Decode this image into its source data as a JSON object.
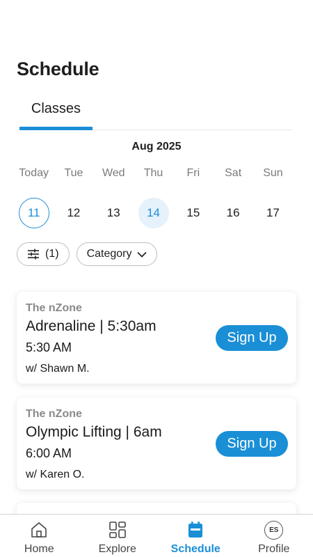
{
  "header": {
    "title": "Schedule"
  },
  "tabs": [
    {
      "label": "Classes",
      "active": true
    }
  ],
  "calendar": {
    "month": "Aug 2025",
    "weekdays": [
      "Today",
      "Tue",
      "Wed",
      "Thu",
      "Fri",
      "Sat",
      "Sun"
    ],
    "dates": [
      "11",
      "12",
      "13",
      "14",
      "15",
      "16",
      "17"
    ],
    "today_index": 0,
    "selected_index": 3
  },
  "filters": {
    "filter_count": "(1)",
    "category_label": "Category"
  },
  "classes": [
    {
      "venue": "The nZone",
      "name": "Adrenaline | 5:30am",
      "time": "5:30 AM",
      "instructor": "w/ Shawn M.",
      "button": "Sign Up"
    },
    {
      "venue": "The nZone",
      "name": "Olympic Lifting | 6am",
      "time": "6:00 AM",
      "instructor": "w/ Karen O.",
      "button": "Sign Up"
    }
  ],
  "bottom_nav": {
    "items": [
      {
        "label": "Home",
        "icon": "home-icon"
      },
      {
        "label": "Explore",
        "icon": "explore-grid-icon"
      },
      {
        "label": "Schedule",
        "icon": "calendar-icon",
        "active": true
      },
      {
        "label": "Profile",
        "icon": "avatar"
      }
    ],
    "avatar_initials": "ES"
  },
  "colors": {
    "accent": "#1a8fd6",
    "selected_bg": "#e5f1fb",
    "muted": "#7a7a7a"
  }
}
